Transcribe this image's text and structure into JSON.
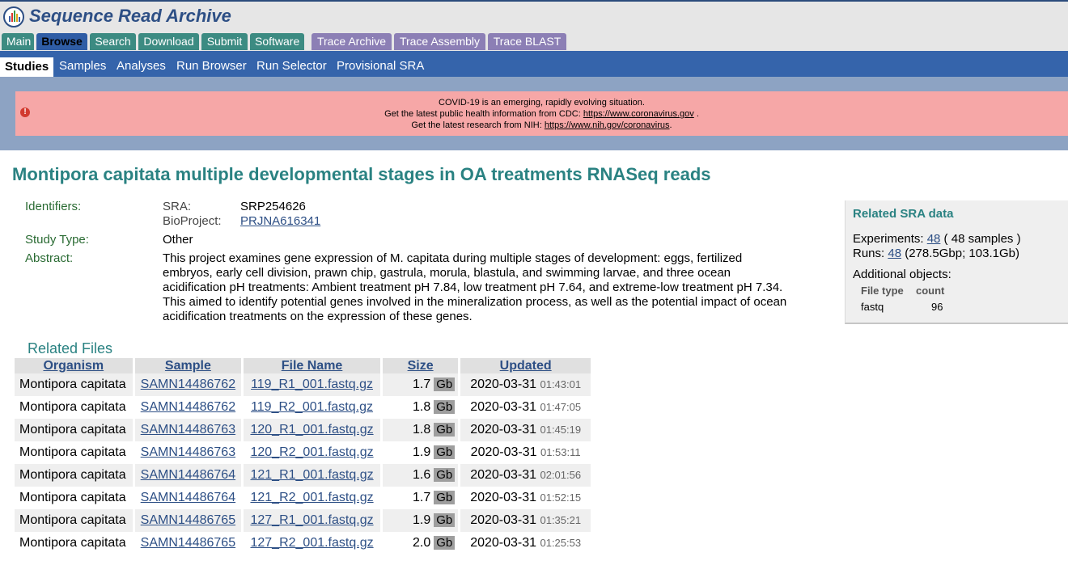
{
  "app": {
    "title": "Sequence Read Archive"
  },
  "main_tabs": [
    "Main",
    "Browse",
    "Search",
    "Download",
    "Submit",
    "Software",
    "Trace Archive",
    "Trace Assembly",
    "Trace BLAST"
  ],
  "sub_tabs": [
    "Studies",
    "Samples",
    "Analyses",
    "Run Browser",
    "Run Selector",
    "Provisional SRA"
  ],
  "alert": {
    "line1": "COVID-19 is an emerging, rapidly evolving situation.",
    "line2_prefix": "Get the latest public health information from CDC: ",
    "line2_link": "https://www.coronavirus.gov",
    "line2_suffix": " .",
    "line3_prefix": "Get the latest research from NIH: ",
    "line3_link": "https://www.nih.gov/coronavirus",
    "line3_suffix": "."
  },
  "study": {
    "title": "Montipora capitata multiple developmental stages in OA treatments RNASeq reads",
    "identifiers_label": "Identifiers:",
    "sra_label": "SRA:",
    "sra_value": "SRP254626",
    "bioproject_label": "BioProject:",
    "bioproject_value": "PRJNA616341",
    "study_type_label": "Study Type:",
    "study_type_value": "Other",
    "abstract_label": "Abstract:",
    "abstract": "This project examines gene expression of M. capitata during multiple stages of development: eggs, fertilized embryos, early cell division, prawn chip, gastrula, morula, blastula, and swimming larvae, and three ocean acidification pH treatments: Ambient treatment pH 7.84, low treatment pH 7.64, and extreme-low treatment pH 7.34. This aimed to identify potential genes involved in the mineralization process, as well as the potential impact of ocean acidification treatments on the expression of these genes."
  },
  "related_sra": {
    "title": "Related SRA data",
    "experiments_label": "Experiments: ",
    "experiments_count": "48",
    "experiments_note": " ( 48 samples )",
    "runs_label": "Runs: ",
    "runs_count": "48",
    "runs_note": " (278.5Gbp; 103.1Gb)",
    "additional_label": "Additional objects:",
    "col_file_type": "File type",
    "col_count": "count",
    "file_type": "fastq",
    "file_count": "96"
  },
  "related_files": {
    "title": "Related Files",
    "columns": [
      "Organism",
      "Sample",
      "File Name",
      "Size",
      "Updated"
    ],
    "rows": [
      {
        "organism": "Montipora capitata",
        "sample": "SAMN14486762",
        "file": "119_R1_001.fastq.gz",
        "size": "1.7",
        "unit": "Gb",
        "date": "2020-03-31",
        "time": "01:43:01"
      },
      {
        "organism": "Montipora capitata",
        "sample": "SAMN14486762",
        "file": "119_R2_001.fastq.gz",
        "size": "1.8",
        "unit": "Gb",
        "date": "2020-03-31",
        "time": "01:47:05"
      },
      {
        "organism": "Montipora capitata",
        "sample": "SAMN14486763",
        "file": "120_R1_001.fastq.gz",
        "size": "1.8",
        "unit": "Gb",
        "date": "2020-03-31",
        "time": "01:45:19"
      },
      {
        "organism": "Montipora capitata",
        "sample": "SAMN14486763",
        "file": "120_R2_001.fastq.gz",
        "size": "1.9",
        "unit": "Gb",
        "date": "2020-03-31",
        "time": "01:53:11"
      },
      {
        "organism": "Montipora capitata",
        "sample": "SAMN14486764",
        "file": "121_R1_001.fastq.gz",
        "size": "1.6",
        "unit": "Gb",
        "date": "2020-03-31",
        "time": "02:01:56"
      },
      {
        "organism": "Montipora capitata",
        "sample": "SAMN14486764",
        "file": "121_R2_001.fastq.gz",
        "size": "1.7",
        "unit": "Gb",
        "date": "2020-03-31",
        "time": "01:52:15"
      },
      {
        "organism": "Montipora capitata",
        "sample": "SAMN14486765",
        "file": "127_R1_001.fastq.gz",
        "size": "1.9",
        "unit": "Gb",
        "date": "2020-03-31",
        "time": "01:35:21"
      },
      {
        "organism": "Montipora capitata",
        "sample": "SAMN14486765",
        "file": "127_R2_001.fastq.gz",
        "size": "2.0",
        "unit": "Gb",
        "date": "2020-03-31",
        "time": "01:25:53"
      }
    ]
  },
  "colors": {
    "teal": "#2a8282",
    "nav_blue": "#3564ab",
    "tab_green": "#3c8b82",
    "tab_purple": "#8c7fb5",
    "alert_pink": "#f6a7a7",
    "link": "#2d4f85"
  },
  "icons": {
    "logo": "sra-logo-icon",
    "alert": "alert-circle-icon"
  }
}
